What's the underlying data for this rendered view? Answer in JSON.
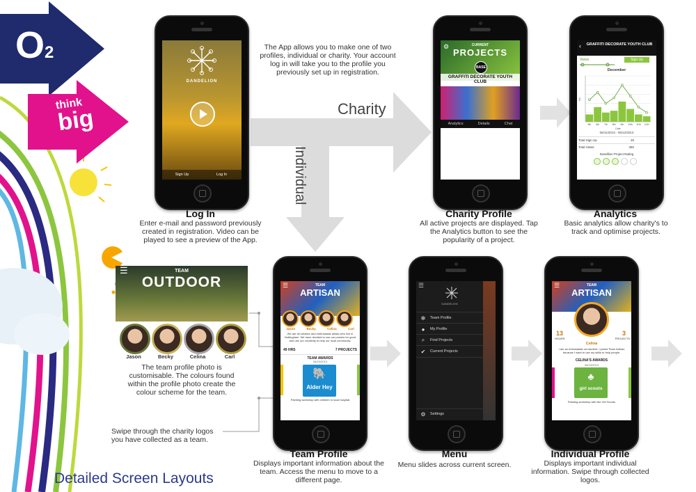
{
  "footer_title": "Detailed Screen Layouts",
  "brand": {
    "o2": "O",
    "o2_sub": "2",
    "think": "think",
    "big": "big"
  },
  "intro_note": "The App allows you to make one of two profiles, individual or charity.  Your account log in will take you to the profile you previously set up in registration.",
  "flow_labels": {
    "charity": "Charity",
    "individual": "Individual"
  },
  "login": {
    "app_name": "DANDELION",
    "signup": "Sign Up",
    "login": "Log In",
    "title": "Log In",
    "desc": "Enter e-mail and password previously created in registration.  Video can be played to see a preview of the App."
  },
  "charity": {
    "header_small": "CURRENT",
    "header": "PROJECTS",
    "badge": "BASE",
    "banner": "GRAFFITI DECORATE YOUTH CLUB",
    "tabs": [
      "Analytics",
      "Details",
      "Chat"
    ],
    "title": "Charity Profile",
    "desc": "All active projects are displayed.  Tap the Analytics button to see the popularity of a project."
  },
  "analytics": {
    "header": "GRAFFITI DECORATE YOUTH CLUB",
    "toggle_views": "Views",
    "toggle_signup": "Sign Up",
    "month": "December",
    "date_range": "06/11/2013 - 06/12/2013",
    "total_signup_label": "Total Sign Up",
    "total_signup_value": "25",
    "total_views_label": "Total Views",
    "total_views_value": "350",
    "rating_label": "Dandilion Project Rating",
    "title": "Analytics",
    "desc": "Basic analytics allow charity's to track and optimise projects."
  },
  "outdoor": {
    "team_small": "TEAM",
    "team_name": "OUTDOOR",
    "members": [
      "Jason",
      "Becky",
      "Celina",
      "Carl"
    ],
    "caption": "The team profile photo is customisable.  The colours found within the profile photo create the colour scheme for the team.",
    "swipe_note": "Swipe through the charity logos you have collected as a team."
  },
  "team_profile": {
    "team_small": "TEAM",
    "team_name": "ARTISAN",
    "members": [
      "Jason",
      "Becky",
      "Celina",
      "Carl"
    ],
    "about": "We are all creative and enthusiastic artists who live in Nottingham. We have decided to use our powers for good and use our creativity to help our local community.",
    "stat_left": "49",
    "stat_left_label": "HRS",
    "stat_right": "7",
    "stat_right_label": "PROJECTS",
    "awards_label": "TEAM AWARDS",
    "award_date": "06/10/2013",
    "award_logo": "Alder Hey",
    "award_caption": "Painting workshop with children in local hospital",
    "title": "Team Profile",
    "desc": "Displays important information about the team.  Access the menu to move to a different page."
  },
  "menu": {
    "app_name": "DANDELION",
    "items": [
      "Team Profile",
      "My Profile",
      "Find Projects",
      "Current Projects"
    ],
    "settings": "Settings",
    "title": "Menu",
    "desc": "Menu slides across current screen."
  },
  "individual": {
    "team_small": "TEAM",
    "team_name": "ARTISAN",
    "stat_left": "13",
    "stat_left_label": "HOURS",
    "stat_right": "3",
    "stat_right_label": "PROJECTS",
    "name": "Celina",
    "bio": "I am an enthusiastic art student. I joined Team Artisan because I want to use my skills to help people.",
    "awards_label": "CELINA'S AWARDS",
    "award_date": "06/10/2013",
    "award_logo": "girl scouts",
    "award_caption": "Painting workshop with the Girl Scouts",
    "title": "Individual Profile",
    "desc": "Displays important individual information.  Swipe through collected logos."
  },
  "chart_data": {
    "type": "bar",
    "categories": [
      "5th",
      "6th",
      "7th",
      "8th",
      "9th",
      "10th",
      "11th",
      "12th"
    ],
    "values": [
      8,
      16,
      10,
      12,
      22,
      14,
      8,
      6
    ],
    "line_values": [
      24,
      32,
      20,
      26,
      40,
      28,
      16,
      10
    ],
    "ylim": [
      0,
      50
    ],
    "xlabel": "Date",
    "ylabel": "No."
  },
  "colors": {
    "accent_green": "#8cc63f",
    "o2_navy": "#1f2b6c",
    "pink": "#e2128c",
    "artisan_yellow": "#f5a623"
  }
}
